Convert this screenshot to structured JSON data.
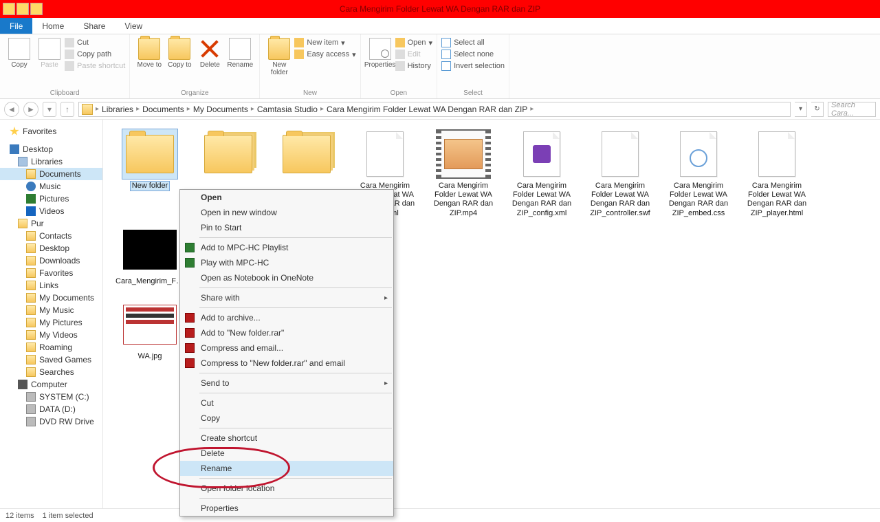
{
  "window": {
    "title": "Cara Mengirim Folder Lewat WA Dengan RAR dan ZIP"
  },
  "tabs": {
    "file": "File",
    "home": "Home",
    "share": "Share",
    "view": "View"
  },
  "ribbon": {
    "clipboard": {
      "label": "Clipboard",
      "copy": "Copy",
      "paste": "Paste",
      "cut": "Cut",
      "copypath": "Copy path",
      "pasteshort": "Paste shortcut"
    },
    "organize": {
      "label": "Organize",
      "moveto": "Move to",
      "copyto": "Copy to",
      "delete": "Delete",
      "rename": "Rename"
    },
    "new": {
      "label": "New",
      "newfolder": "New folder",
      "newitem": "New item",
      "easyaccess": "Easy access"
    },
    "open": {
      "label": "Open",
      "properties": "Properties",
      "open": "Open",
      "edit": "Edit",
      "history": "History"
    },
    "select": {
      "label": "Select",
      "all": "Select all",
      "none": "Select none",
      "invert": "Invert selection"
    }
  },
  "breadcrumb": [
    "Libraries",
    "Documents",
    "My Documents",
    "Camtasia Studio",
    "Cara Mengirim Folder Lewat WA Dengan RAR dan ZIP"
  ],
  "search_placeholder": "Search Cara...",
  "sidebar": {
    "favorites": "Favorites",
    "desktop": "Desktop",
    "libraries": "Libraries",
    "documents": "Documents",
    "music": "Music",
    "pictures": "Pictures",
    "videos": "Videos",
    "pur": "Pur",
    "pur_items": [
      "Contacts",
      "Desktop",
      "Downloads",
      "Favorites",
      "Links",
      "My Documents",
      "My Music",
      "My Pictures",
      "My Videos",
      "Roaming",
      "Saved Games",
      "Searches"
    ],
    "computer": "Computer",
    "drives": [
      "SYSTEM (C:)",
      "DATA (D:)",
      "DVD RW Drive"
    ]
  },
  "files": [
    {
      "name": "New folder",
      "type": "folder",
      "selected": true
    },
    {
      "name": "",
      "type": "folder-multi"
    },
    {
      "name": "",
      "type": "folder-multi"
    },
    {
      "name": "Cara Mengirim Folder Lewat WA Dengan RAR dan ZIP.html",
      "type": "page"
    },
    {
      "name": "Cara Mengirim Folder Lewat WA Dengan RAR dan ZIP.mp4",
      "type": "video"
    },
    {
      "name": "Cara Mengirim Folder Lewat WA Dengan RAR dan ZIP_config.xml",
      "type": "page-acc"
    },
    {
      "name": "Cara Mengirim Folder Lewat WA Dengan RAR dan ZIP_controller.swf",
      "type": "page"
    },
    {
      "name": "Cara Mengirim Folder Lewat WA Dengan RAR dan ZIP_embed.css",
      "type": "page-js"
    },
    {
      "name": "Cara Mengirim Folder Lewat WA Dengan RAR dan ZIP_player.html",
      "type": "page"
    },
    {
      "name": "Cara_Mengirim_Folder_Lewat_WA_Dengan_RAR_dan_ZIP_First_Frame",
      "type": "black"
    }
  ],
  "file_row2": {
    "name": "WA.jpg"
  },
  "context": {
    "open": "Open",
    "openwin": "Open in new window",
    "pin": "Pin to Start",
    "mpc1": "Add to MPC-HC Playlist",
    "mpc2": "Play with MPC-HC",
    "onenote": "Open as Notebook in OneNote",
    "share": "Share with",
    "arch1": "Add to archive...",
    "arch2": "Add to \"New folder.rar\"",
    "arch3": "Compress and email...",
    "arch4": "Compress to \"New folder.rar\" and email",
    "send": "Send to",
    "cut": "Cut",
    "copy": "Copy",
    "shortcut": "Create shortcut",
    "delete": "Delete",
    "rename": "Rename",
    "loc": "Open folder location",
    "prop": "Properties"
  },
  "status": {
    "count": "12 items",
    "sel": "1 item selected"
  }
}
